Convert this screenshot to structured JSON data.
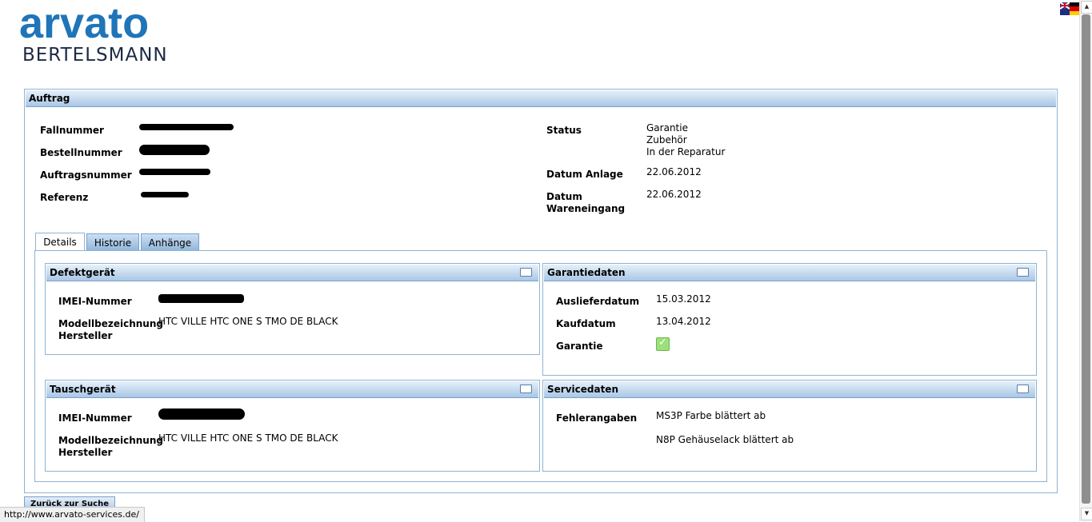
{
  "logo": {
    "brand": "arvato",
    "sub": "BERTELSMANN"
  },
  "auftrag": {
    "title": "Auftrag",
    "left_labels": [
      "Fallnummer",
      "Bestellnummer",
      "Auftragsnummer",
      "Referenz"
    ],
    "status_label": "Status",
    "status_values": [
      "Garantie",
      "Zubehör",
      "In der Reparatur"
    ],
    "datum_anlage_label": "Datum Anlage",
    "datum_anlage": "22.06.2012",
    "datum_wareneingang_label_1": "Datum",
    "datum_wareneingang_label_2": "Wareneingang",
    "datum_wareneingang": "22.06.2012"
  },
  "tabs": [
    "Details",
    "Historie",
    "Anhänge"
  ],
  "defektgeraet": {
    "title": "Defektgerät",
    "imei_label": "IMEI-Nummer",
    "modell_label": "Modellbezeichnung",
    "hersteller_label": "Hersteller",
    "modell_value": "HTC VILLE HTC ONE S TMO DE BLACK"
  },
  "tauschgeraet": {
    "title": "Tauschgerät",
    "imei_label": "IMEI-Nummer",
    "modell_label": "Modellbezeichnung",
    "hersteller_label": "Hersteller",
    "modell_value": "HTC VILLE HTC ONE S TMO DE BLACK"
  },
  "garantiedaten": {
    "title": "Garantiedaten",
    "auslieferdatum_label": "Auslieferdatum",
    "auslieferdatum": "15.03.2012",
    "kaufdatum_label": "Kaufdatum",
    "kaufdatum": "13.04.2012",
    "garantie_label": "Garantie",
    "garantie_icon": "checkmark-icon"
  },
  "servicedaten": {
    "title": "Servicedaten",
    "fehlerangaben_label": "Fehlerangaben",
    "fehler": [
      "MS3P Farbe blättert ab",
      "N8P Gehäuselack blättert ab"
    ]
  },
  "back_button": "Zurück zur Suche",
  "status_url": "http://www.arvato-services.de/",
  "colors": {
    "brand": "#1f75b8",
    "header_gradient_bottom": "#a9c7e6",
    "border": "#8fb3d3"
  }
}
